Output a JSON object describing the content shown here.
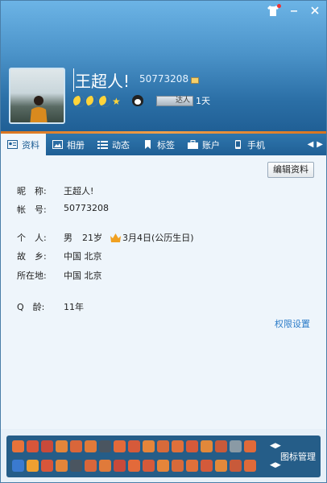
{
  "header": {
    "nickname": "王超人!",
    "qq_number": "50773208",
    "level_icons": [
      "moon",
      "moon",
      "moon",
      "star"
    ],
    "daren_label": "达人",
    "daren_days": "1天"
  },
  "tabs": [
    {
      "label": "资料",
      "icon": "profile-card-icon",
      "active": true
    },
    {
      "label": "相册",
      "icon": "photo-album-icon",
      "active": false
    },
    {
      "label": "动态",
      "icon": "feed-list-icon",
      "active": false
    },
    {
      "label": "标签",
      "icon": "bookmark-icon",
      "active": false
    },
    {
      "label": "账户",
      "icon": "wallet-icon",
      "active": false
    },
    {
      "label": "手机",
      "icon": "phone-icon",
      "active": false
    }
  ],
  "profile": {
    "edit_button": "编辑资料",
    "nickname_label": "昵　称:",
    "nickname_value": "王超人!",
    "account_label": "帐　号:",
    "account_value": "50773208",
    "personal_label": "个　人:",
    "gender": "男",
    "age": "21岁",
    "birthday": "3月4日(公历生日)",
    "hometown_label": "故　乡:",
    "hometown_value": "中国 北京",
    "location_label": "所在地:",
    "location_value": "中国 北京",
    "qage_label": "Q　龄:",
    "qage_value": "11年",
    "permission_link": "权限设置"
  },
  "footer": {
    "icon_manager": "图标管理"
  },
  "colors": {
    "header_top": "#6cb4e6",
    "header_bottom": "#1f5e94",
    "accent_orange": "#e07b25",
    "link_blue": "#2a7bc8",
    "panel_bg": "#eef5fb"
  }
}
